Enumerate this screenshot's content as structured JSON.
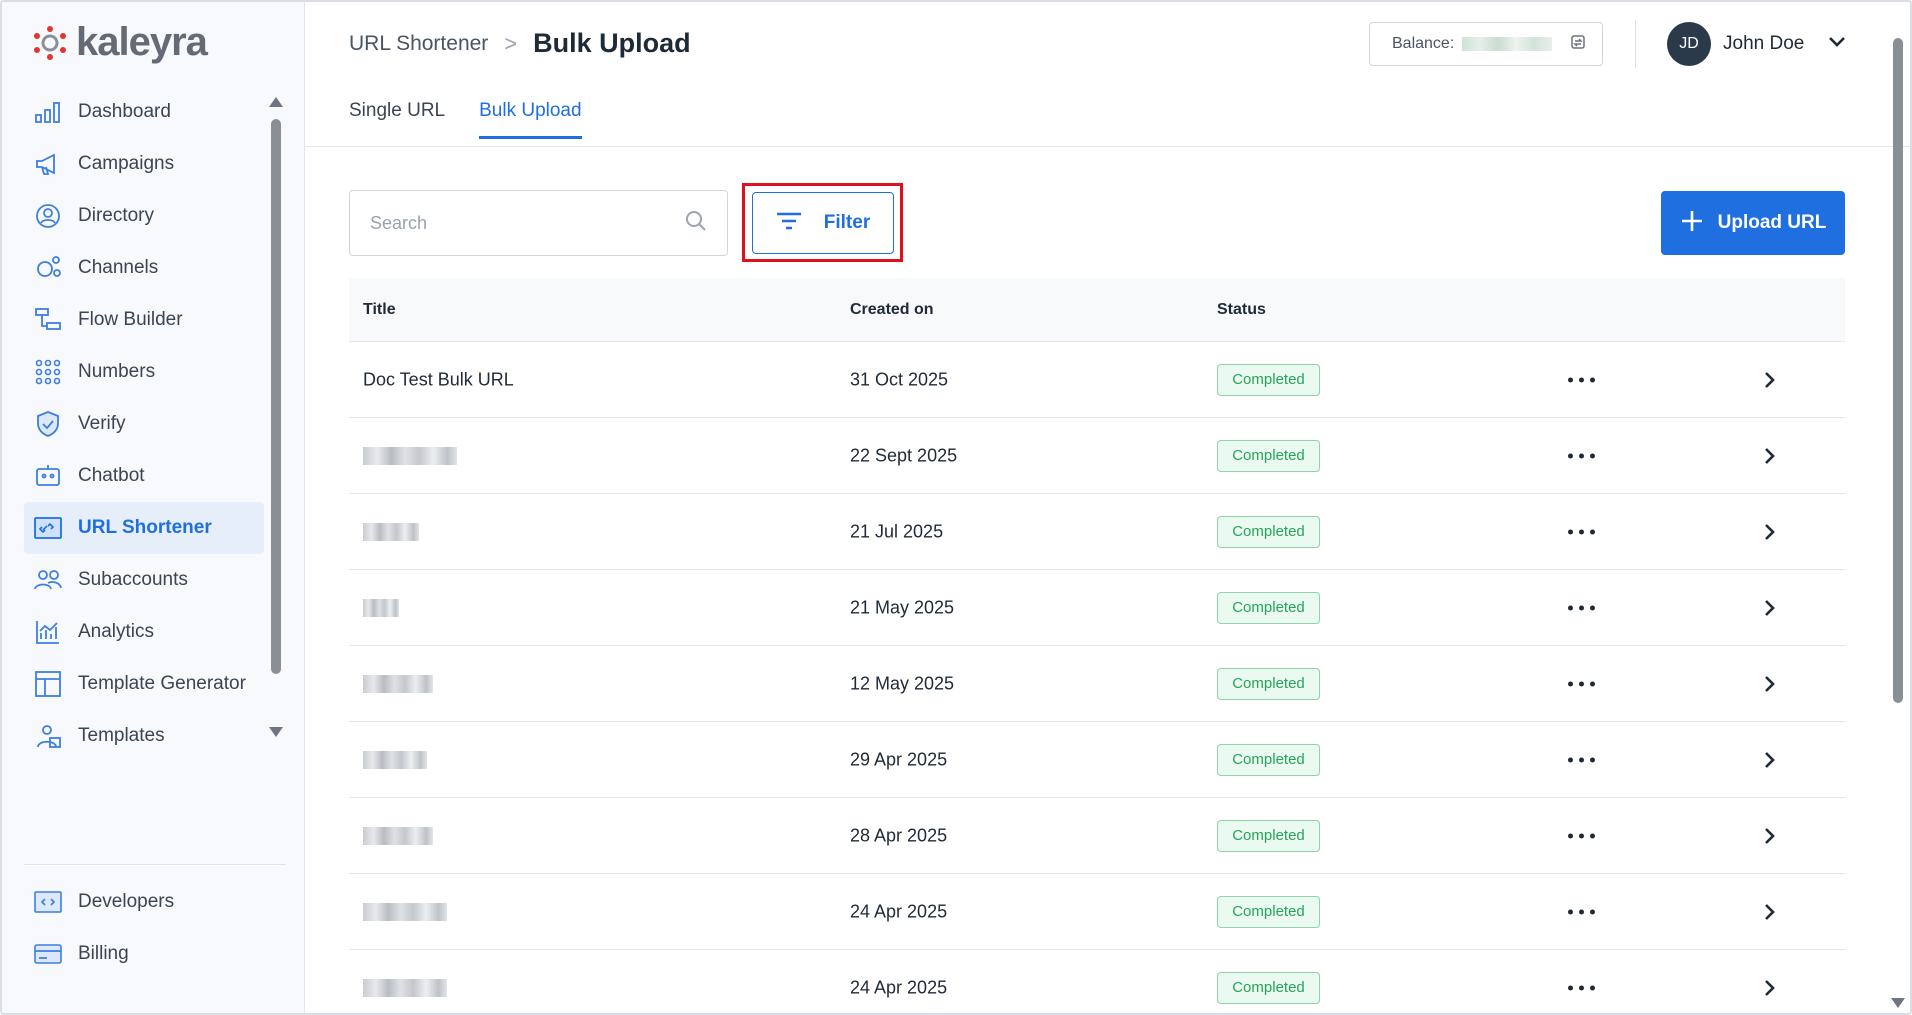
{
  "brand": {
    "name": "kaleyra"
  },
  "sidebar": {
    "items": [
      {
        "label": "Dashboard",
        "icon": "bar-chart-icon"
      },
      {
        "label": "Campaigns",
        "icon": "megaphone-icon"
      },
      {
        "label": "Directory",
        "icon": "contact-icon"
      },
      {
        "label": "Channels",
        "icon": "channels-icon"
      },
      {
        "label": "Flow Builder",
        "icon": "flow-icon"
      },
      {
        "label": "Numbers",
        "icon": "dialpad-icon"
      },
      {
        "label": "Verify",
        "icon": "shield-icon"
      },
      {
        "label": "Chatbot",
        "icon": "bot-icon"
      },
      {
        "label": "URL Shortener",
        "icon": "link-icon",
        "active": true
      },
      {
        "label": "Subaccounts",
        "icon": "users-icon"
      },
      {
        "label": "Analytics",
        "icon": "analytics-icon"
      },
      {
        "label": "Template Generator",
        "icon": "layout-icon"
      },
      {
        "label": "Templates",
        "icon": "template-user-icon"
      }
    ],
    "bottom_items": [
      {
        "label": "Developers",
        "icon": "code-icon"
      },
      {
        "label": "Billing",
        "icon": "card-icon"
      }
    ]
  },
  "header": {
    "breadcrumb_parent": "URL Shortener",
    "breadcrumb_sep": ">",
    "title": "Bulk Upload",
    "balance_label": "Balance:",
    "user_initials": "JD",
    "user_name": "John Doe"
  },
  "tabs": [
    {
      "label": "Single URL",
      "active": false
    },
    {
      "label": "Bulk Upload",
      "active": true
    }
  ],
  "toolbar": {
    "search_placeholder": "Search",
    "filter_label": "Filter",
    "upload_label": "Upload URL"
  },
  "table": {
    "columns": [
      "Title",
      "Created on",
      "Status"
    ],
    "rows": [
      {
        "title": "Doc Test Bulk URL",
        "created": "31 Oct 2025",
        "status": "Completed"
      },
      {
        "title": "",
        "created": "22 Sept 2025",
        "status": "Completed"
      },
      {
        "title": "",
        "created": "21 Jul 2025",
        "status": "Completed"
      },
      {
        "title": "",
        "created": "21 May 2025",
        "status": "Completed"
      },
      {
        "title": "",
        "created": "12 May 2025",
        "status": "Completed"
      },
      {
        "title": "",
        "created": "29 Apr 2025",
        "status": "Completed"
      },
      {
        "title": "",
        "created": "28 Apr 2025",
        "status": "Completed"
      },
      {
        "title": "",
        "created": "24 Apr 2025",
        "status": "Completed"
      },
      {
        "title": "",
        "created": "24 Apr 2025",
        "status": "Completed"
      }
    ]
  },
  "colors": {
    "accent": "#1f6fe0",
    "success": "#27a35a",
    "highlight": "#e0101c"
  }
}
